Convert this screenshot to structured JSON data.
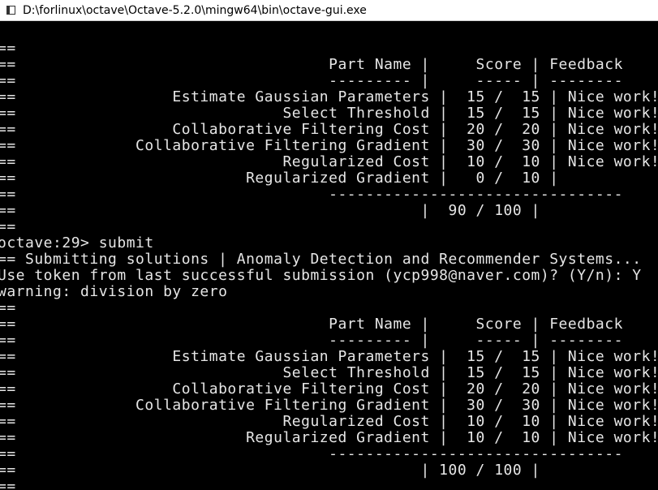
{
  "window": {
    "title": "D:\\forlinux\\octave\\Octave-5.2.0\\mingw64\\bin\\octave-gui.exe"
  },
  "console": {
    "lines": [
      "==",
      "==                                  Part Name |     Score | Feedback",
      "==                                  --------- |     ----- | --------",
      "==                 Estimate Gaussian Parameters |  15 /  15 | Nice work!",
      "==                             Select Threshold |  15 /  15 | Nice work!",
      "==                 Collaborative Filtering Cost |  20 /  20 | Nice work!",
      "==             Collaborative Filtering Gradient |  30 /  30 | Nice work!",
      "==                             Regularized Cost |  10 /  10 | Nice work!",
      "==                         Regularized Gradient |   0 /  10 |",
      "==                                  --------------------------------",
      "==                                            |  90 / 100 |",
      "==",
      "octave:29> submit",
      "== Submitting solutions | Anomaly Detection and Recommender Systems...",
      "Use token from last successful submission (ycp998@naver.com)? (Y/n): Y",
      "warning: division by zero",
      "==",
      "==                                  Part Name |     Score | Feedback",
      "==                                  --------- |     ----- | --------",
      "==                 Estimate Gaussian Parameters |  15 /  15 | Nice work!",
      "==                             Select Threshold |  15 /  15 | Nice work!",
      "==                 Collaborative Filtering Cost |  20 /  20 | Nice work!",
      "==             Collaborative Filtering Gradient |  30 /  30 | Nice work!",
      "==                             Regularized Cost |  10 /  10 | Nice work!",
      "==                         Regularized Gradient |  10 /  10 | Nice work!",
      "==                                  --------------------------------",
      "==                                            | 100 / 100 |",
      "=="
    ]
  }
}
